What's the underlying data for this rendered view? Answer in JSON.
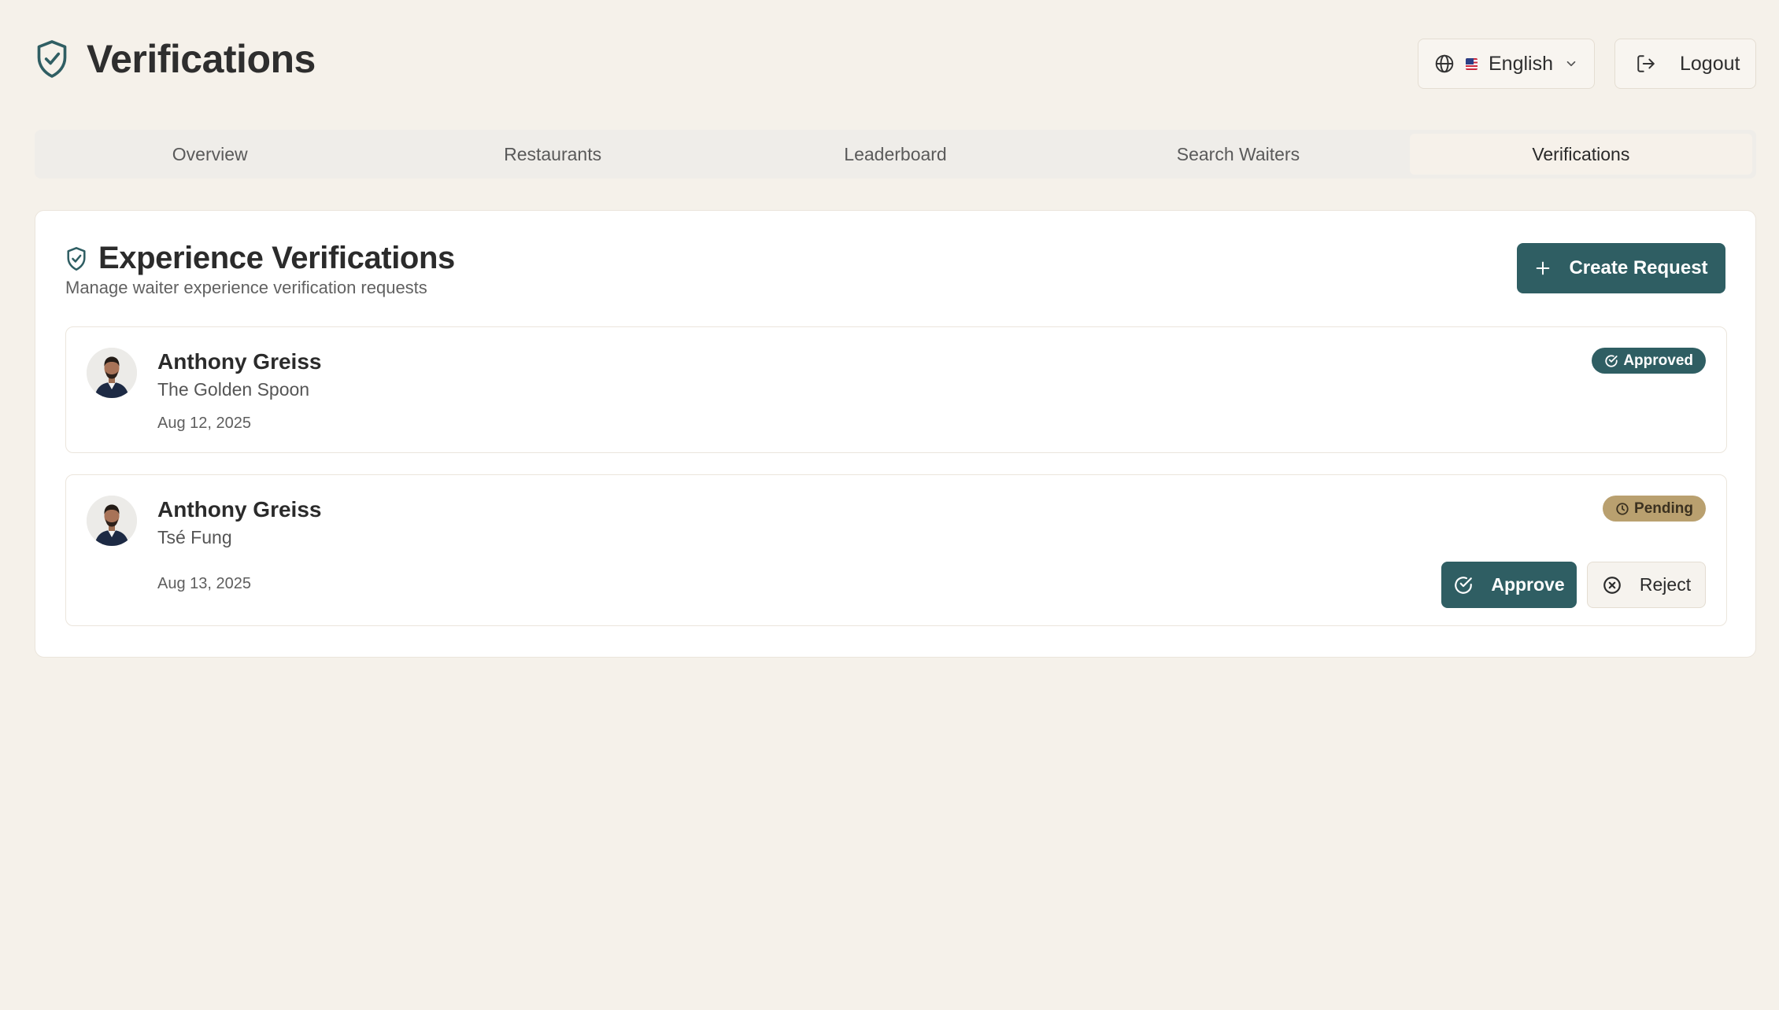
{
  "header": {
    "title": "Verifications",
    "language": {
      "flag": "🇺🇸",
      "label": "English"
    },
    "logout_label": "Logout"
  },
  "tabs": [
    {
      "label": "Overview",
      "active": false
    },
    {
      "label": "Restaurants",
      "active": false
    },
    {
      "label": "Leaderboard",
      "active": false
    },
    {
      "label": "Search Waiters",
      "active": false
    },
    {
      "label": "Verifications",
      "active": true
    }
  ],
  "section": {
    "title": "Experience Verifications",
    "subtitle": "Manage waiter experience verification requests",
    "create_label": "Create Request"
  },
  "requests": [
    {
      "name": "Anthony Greiss",
      "restaurant": "The Golden Spoon",
      "date": "Aug 12, 2025",
      "status": "Approved"
    },
    {
      "name": "Anthony Greiss",
      "restaurant": "Tsé Fung",
      "date": "Aug 13, 2025",
      "status": "Pending",
      "approve_label": "Approve",
      "reject_label": "Reject"
    }
  ],
  "colors": {
    "background": "#f5f1ea",
    "accent": "#2f5e63",
    "pending": "#b9a06f"
  }
}
